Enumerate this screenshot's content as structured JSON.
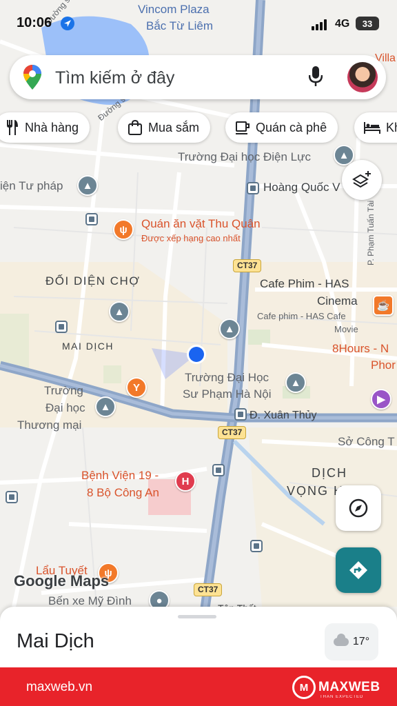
{
  "status_bar": {
    "time": "10:06",
    "network": "4G",
    "battery": "33"
  },
  "search": {
    "placeholder": "Tìm kiếm ở đây"
  },
  "chips": [
    {
      "label": "Nhà hàng",
      "icon": "fork-knife-icon"
    },
    {
      "label": "Mua sắm",
      "icon": "shopping-bag-icon"
    },
    {
      "label": "Quán cà phê",
      "icon": "coffee-cup-icon"
    },
    {
      "label": "Kh",
      "icon": "hotel-bed-icon"
    }
  ],
  "map": {
    "labels": {
      "vincom1": "Vincom Plaza",
      "vincom2": "Bắc Từ Liêm",
      "villa": "Villa",
      "duong_so_2": "Đường số 2",
      "duong_so_1": "Đường số 1",
      "dh_dien_luc": "Trường Đại học Điện Lực",
      "tu_phap": "iện Tư pháp",
      "hoang_quoc_viet": "Hoàng Quốc V",
      "pham_tuan_tai": "P. Phạm Tuấn Tài",
      "quan_an": "Quán ăn vặt Thu Quân",
      "quan_an_sub": "Được xếp hạng cao nhất",
      "doi_dien_cho": "ĐỐI DIỆN CHỢ",
      "cafe_phim1": "Cafe Phim - HAS",
      "cafe_phim2": "Cinema",
      "cafe_phim_sub1": "Cafe phim - HAS Cafe",
      "cafe_phim_sub2": "Movie",
      "hours1": "8Hours - N",
      "hours2": "Phor",
      "mai_dich": "MAI DỊCH",
      "dhsp1": "Trường Đại Học",
      "dhsp2": "Sư Phạm Hà Nội",
      "dhtm1": "Trường",
      "dhtm2": "Đại học",
      "dhtm3": "Thương mại",
      "xuan_thuy": "Đ. Xuân Thủy",
      "so_cong": "Sở Công T",
      "benh_vien1": "Bệnh Viện 19 -",
      "benh_vien2": "8 Bộ Công An",
      "dich_vong1": "DỊCH",
      "dich_vong2": "VỌNG H",
      "lau_tuyet": "Lẩu Tuyết",
      "ben_xe": "Bến xe Mỹ Đình",
      "ton_that": "Tôn Thất"
    },
    "road_shields": [
      "CT37",
      "CT37",
      "CT37"
    ]
  },
  "google_logo": "Google Maps",
  "sheet": {
    "place_name": "Mai Dịch",
    "temperature": "17°"
  },
  "footer": {
    "site": "maxweb.vn",
    "brand": "MAXWEB",
    "tagline": "THAN EXPECTED"
  }
}
